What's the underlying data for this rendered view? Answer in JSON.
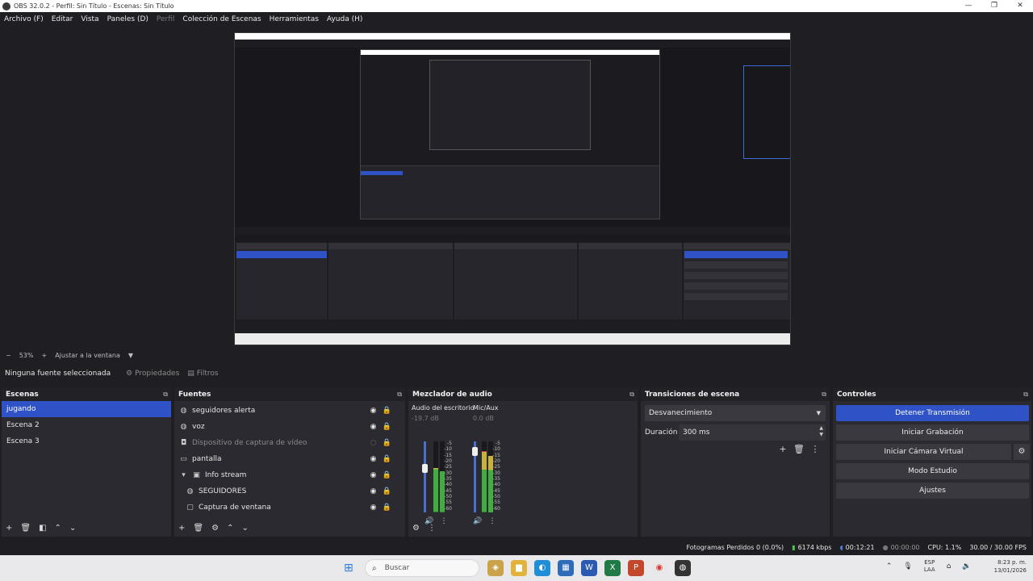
{
  "window": {
    "title": "OBS 32.0.2 - Perfil: Sin Título - Escenas: Sin Título",
    "controls": [
      "—",
      "❐",
      "✕"
    ]
  },
  "menu": {
    "items": [
      "Archivo (F)",
      "Editar",
      "Vista",
      "Paneles (D)",
      "Perfil",
      "Colección de Escenas",
      "Herramientas",
      "Ayuda (H)"
    ]
  },
  "zoom": {
    "minus": "−",
    "level": "53%",
    "plus": "+",
    "fit_label": "Ajustar a la ventana",
    "caret": "▼"
  },
  "source_toolbar": {
    "no_selection": "Ninguna fuente seleccionada",
    "properties": "Propiedades",
    "filters": "Filtros"
  },
  "docks": {
    "scenes": {
      "title": "Escenas",
      "items": [
        "jugando",
        "Escena 2",
        "Escena 3"
      ]
    },
    "sources": {
      "title": "Fuentes",
      "items": [
        {
          "label": "seguidores alerta",
          "icon": "globe-icon"
        },
        {
          "label": "voz",
          "icon": "globe-icon"
        },
        {
          "label": "Dispositivo de captura de vídeo",
          "icon": "camera-icon"
        },
        {
          "label": "pantalla",
          "icon": "monitor-icon"
        },
        {
          "label": "Info stream",
          "icon": "folder-icon"
        },
        {
          "label": "SEGUIDORES",
          "icon": "globe-icon"
        },
        {
          "label": "Captura de ventana",
          "icon": "window-icon"
        }
      ]
    },
    "mixer": {
      "title": "Mezclador de audio",
      "channels": [
        {
          "name": "Audio del escritorio",
          "db": "-19.7 dB",
          "level": 0.62
        },
        {
          "name": "Mic/Aux",
          "db": "0.0 dB",
          "level": 0.86
        }
      ],
      "ticks": [
        "-5",
        "-10",
        "-15",
        "-20",
        "-25",
        "-30",
        "-35",
        "-40",
        "-45",
        "-50",
        "-55",
        "-60"
      ]
    },
    "transitions": {
      "title": "Transiciones de escena",
      "selected": "Desvanecimiento",
      "duration_label": "Duración",
      "duration_value": "300 ms"
    },
    "controls": {
      "title": "Controles",
      "buttons": [
        "Detener Transmisión",
        "Iniciar Grabación",
        "Iniciar Cámara Virtual",
        "Modo Estudio",
        "Ajustes"
      ]
    }
  },
  "status": {
    "dropped": "Fotogramas Perdidos 0 (0.0%)",
    "bitrate": "6174 kbps",
    "stream_time": "00:12:21",
    "rec_time": "00:00:00",
    "cpu": "CPU: 1.1%",
    "fps": "30.00 / 30.00 FPS"
  },
  "taskbar": {
    "search": "Buscar",
    "lang_top": "ESP",
    "lang_bottom": "LAA",
    "time": "8:23 p. m.",
    "date": "13/01/2026"
  },
  "colors": {
    "accent": "#2f53c6",
    "background": "#1f1e22",
    "panel": "#2a2a30",
    "meter_green": "#3fae3f",
    "meter_yellow": "#c9b23a",
    "meter_red": "#c23f3f"
  }
}
